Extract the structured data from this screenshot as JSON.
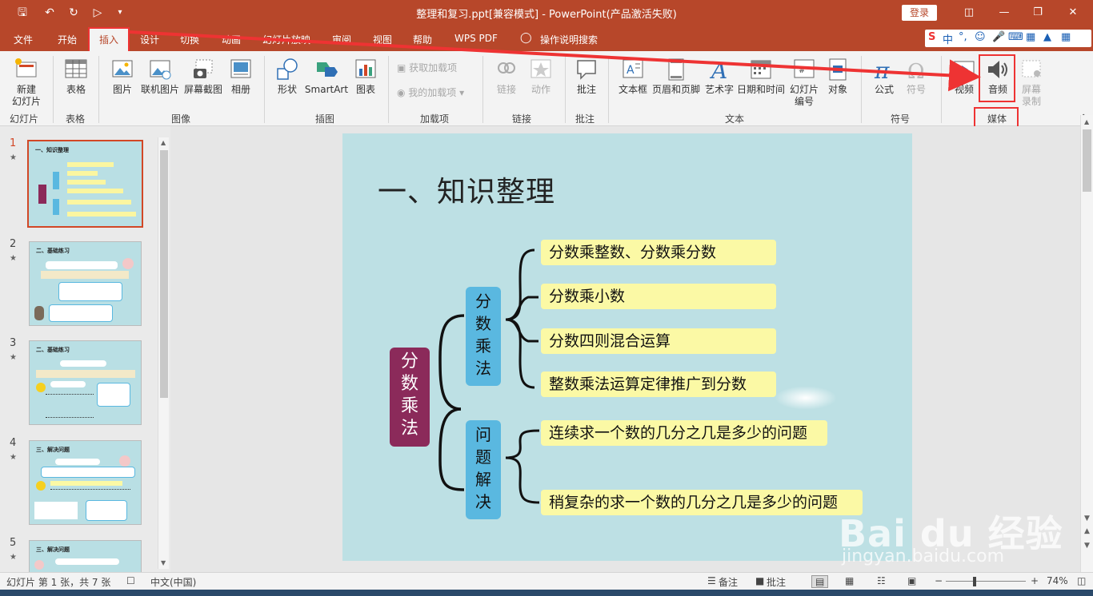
{
  "window": {
    "title": "整理和复习.ppt[兼容模式]  -  PowerPoint(产品激活失败)",
    "login_label": "登录"
  },
  "tabs": [
    "文件",
    "开始",
    "插入",
    "设计",
    "切换",
    "动画",
    "幻灯片放映",
    "审阅",
    "视图",
    "帮助",
    "WPS PDF",
    "操作说明搜索"
  ],
  "active_tab": "插入",
  "ribbon": {
    "new_slide": "新建\n幻灯片",
    "slides_group": "幻灯片",
    "table": "表格",
    "table_group": "表格",
    "picture": "图片",
    "online_picture": "联机图片",
    "screenshot": "屏幕截图",
    "album": "相册",
    "images_group": "图像",
    "shapes": "形状",
    "smartart": "SmartArt",
    "chart": "图表",
    "illustrations_group": "插图",
    "get_addins": "获取加载项",
    "my_addins": "我的加载项",
    "addins_group": "加载项",
    "link": "链接",
    "action": "动作",
    "links_group": "链接",
    "comment": "批注",
    "comments_group": "批注",
    "textbox": "文本框",
    "header_footer": "页眉和页脚",
    "wordart": "艺术字",
    "datetime": "日期和时间",
    "slide_number": "幻灯片\n编号",
    "object": "对象",
    "text_group": "文本",
    "equation": "公式",
    "symbol": "符号",
    "symbols_group": "符号",
    "video": "视频",
    "audio": "音频",
    "screen_recording": "屏幕\n录制",
    "media_group": "媒体"
  },
  "thumbnails": [
    {
      "num": "1",
      "title": "一、知识整理"
    },
    {
      "num": "2",
      "title": "二、基础练习"
    },
    {
      "num": "3",
      "title": "二、基础练习"
    },
    {
      "num": "4",
      "title": "三、解决问题"
    },
    {
      "num": "5",
      "title": "三、解决问题"
    }
  ],
  "slide": {
    "title": "一、知识整理",
    "root": "分数乘法",
    "branch1": "分数乘法",
    "branch2": "问题解决",
    "items1": [
      "分数乘整数、分数乘分数",
      "分数乘小数",
      "分数四则混合运算",
      "整数乘法运算定律推广到分数"
    ],
    "items2": [
      "连续求一个数的几分之几是多少的问题",
      "稍复杂的求一个数的几分之几是多少的问题"
    ]
  },
  "statusbar": {
    "slide_info": "幻灯片 第 1 张，共 7 张",
    "language": "中文(中国)",
    "notes": "备注",
    "comments": "批注",
    "zoom": "74%"
  },
  "watermark": {
    "brand": "Bai du 经验",
    "url": "jingyan.baidu.com"
  },
  "colors": {
    "accent": "#b7472a",
    "slide_bg": "#bde0e4",
    "root_box": "#8b2a5a",
    "branch_box": "#5ab8e0",
    "item_box": "#fbf9a5",
    "highlight": "#e33333"
  }
}
